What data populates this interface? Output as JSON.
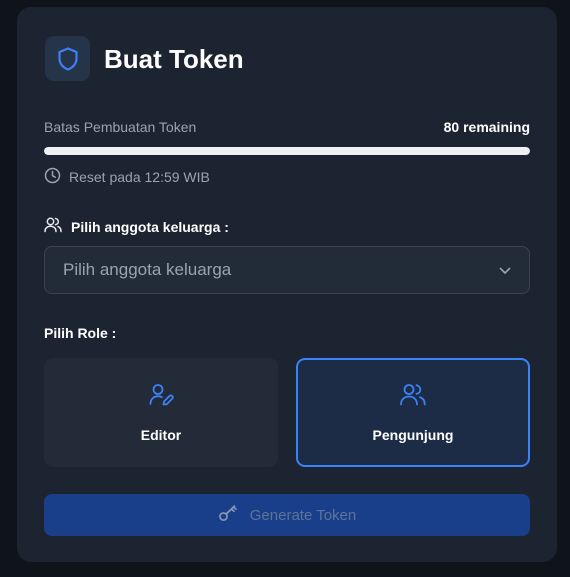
{
  "header": {
    "title": "Buat Token",
    "icon": "shield-icon"
  },
  "limit": {
    "label": "Batas Pembuatan Token",
    "remaining_text": "80 remaining",
    "progress": 1.0,
    "reset_text": "Reset pada 12:59 WIB"
  },
  "member": {
    "label": "Pilih anggota keluarga :",
    "placeholder": "Pilih anggota keluarga"
  },
  "role": {
    "label": "Pilih Role :",
    "options": [
      {
        "label": "Editor",
        "selected": false
      },
      {
        "label": "Pengunjung",
        "selected": true
      }
    ]
  },
  "generate": {
    "label": "Generate Token"
  },
  "colors": {
    "accent": "#3b82f6",
    "card": "#1c2431",
    "button": "#1a3f8a"
  }
}
